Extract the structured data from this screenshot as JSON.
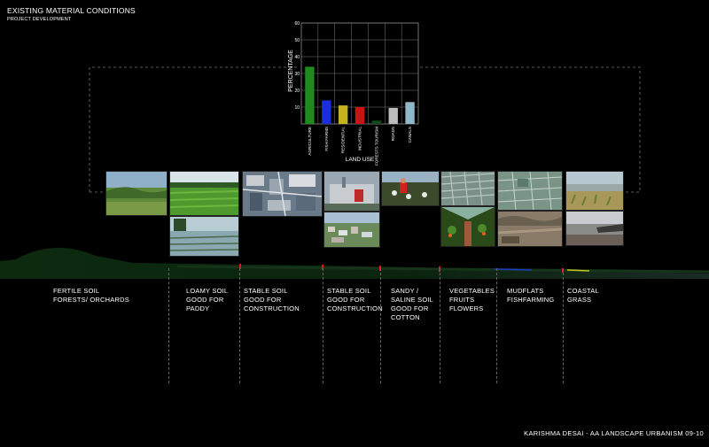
{
  "header": {
    "title": "EXISTING MATERIAL CONDITIONS",
    "subtitle": "PROJECT DEVELOPMENT"
  },
  "chart_data": {
    "type": "bar",
    "title": "",
    "xlabel": "LAND USE",
    "ylabel": "PERCENTAGE",
    "ylim": [
      0,
      60
    ],
    "yticks": [
      10,
      20,
      30,
      40,
      50,
      60
    ],
    "grid": true,
    "categories": [
      "AGRICULTURE",
      "FISH FARMS",
      "RESIDENTIAL",
      "INDUSTRIAL",
      "FORESTS TOURISM",
      "ROADS",
      "CANALS"
    ],
    "values": [
      34,
      14,
      11,
      10,
      2,
      9.5,
      13
    ],
    "colors": [
      "#1f8a1f",
      "#1a2ee0",
      "#c8b21e",
      "#c81414",
      "#0f4a18",
      "#bdbdbd",
      "#8fb8c8"
    ]
  },
  "photos": [
    {
      "name": "photo-fertile-field",
      "scene": "field"
    },
    {
      "name": "photo-paddy-green",
      "scene": "paddy"
    },
    {
      "name": "photo-paddy-flooded",
      "scene": "flooded"
    },
    {
      "name": "photo-aerial-construction",
      "scene": "aerial"
    },
    {
      "name": "photo-industrial-site",
      "scene": "industrial"
    },
    {
      "name": "photo-town-view",
      "scene": "town"
    },
    {
      "name": "photo-cotton-worker",
      "scene": "cotton"
    },
    {
      "name": "photo-greenhouse-roof",
      "scene": "greenhouse"
    },
    {
      "name": "photo-greenhouse-interior",
      "scene": "greenhouse-interior"
    },
    {
      "name": "photo-fish-ponds-aerial",
      "scene": "ponds"
    },
    {
      "name": "photo-mudflat-ground",
      "scene": "mudflat"
    },
    {
      "name": "photo-coastal-grass",
      "scene": "coastal"
    },
    {
      "name": "photo-coastal-shore",
      "scene": "shore"
    }
  ],
  "zones": [
    {
      "name": "zone-fertile-soil",
      "lines": [
        "FERTILE SOIL",
        "FORESTS/ ORCHARDS"
      ]
    },
    {
      "name": "zone-loamy-soil",
      "lines": [
        "LOAMY SOIL",
        "GOOD FOR",
        "PADDY"
      ]
    },
    {
      "name": "zone-stable-soil-1",
      "lines": [
        "STABLE SOIL",
        "GOOD FOR",
        "CONSTRUCTION"
      ]
    },
    {
      "name": "zone-stable-soil-2",
      "lines": [
        "STABLE SOIL",
        "GOOD FOR",
        "CONSTRUCTION"
      ]
    },
    {
      "name": "zone-sandy-soil",
      "lines": [
        "SANDY /",
        "SALINE SOIL",
        "GOOD FOR",
        "COTTON"
      ]
    },
    {
      "name": "zone-vegetables",
      "lines": [
        "VEGETABLES",
        "FRUITS",
        "FLOWERS"
      ]
    },
    {
      "name": "zone-mudflats",
      "lines": [
        "MUDFLATS",
        "FISHFARMING"
      ]
    },
    {
      "name": "zone-coastal",
      "lines": [
        "COASTAL",
        "GRASS"
      ]
    }
  ],
  "footer": {
    "credit": "KARISHMA DESAI - AA LANDSCAPE URBANISM 09-10"
  }
}
